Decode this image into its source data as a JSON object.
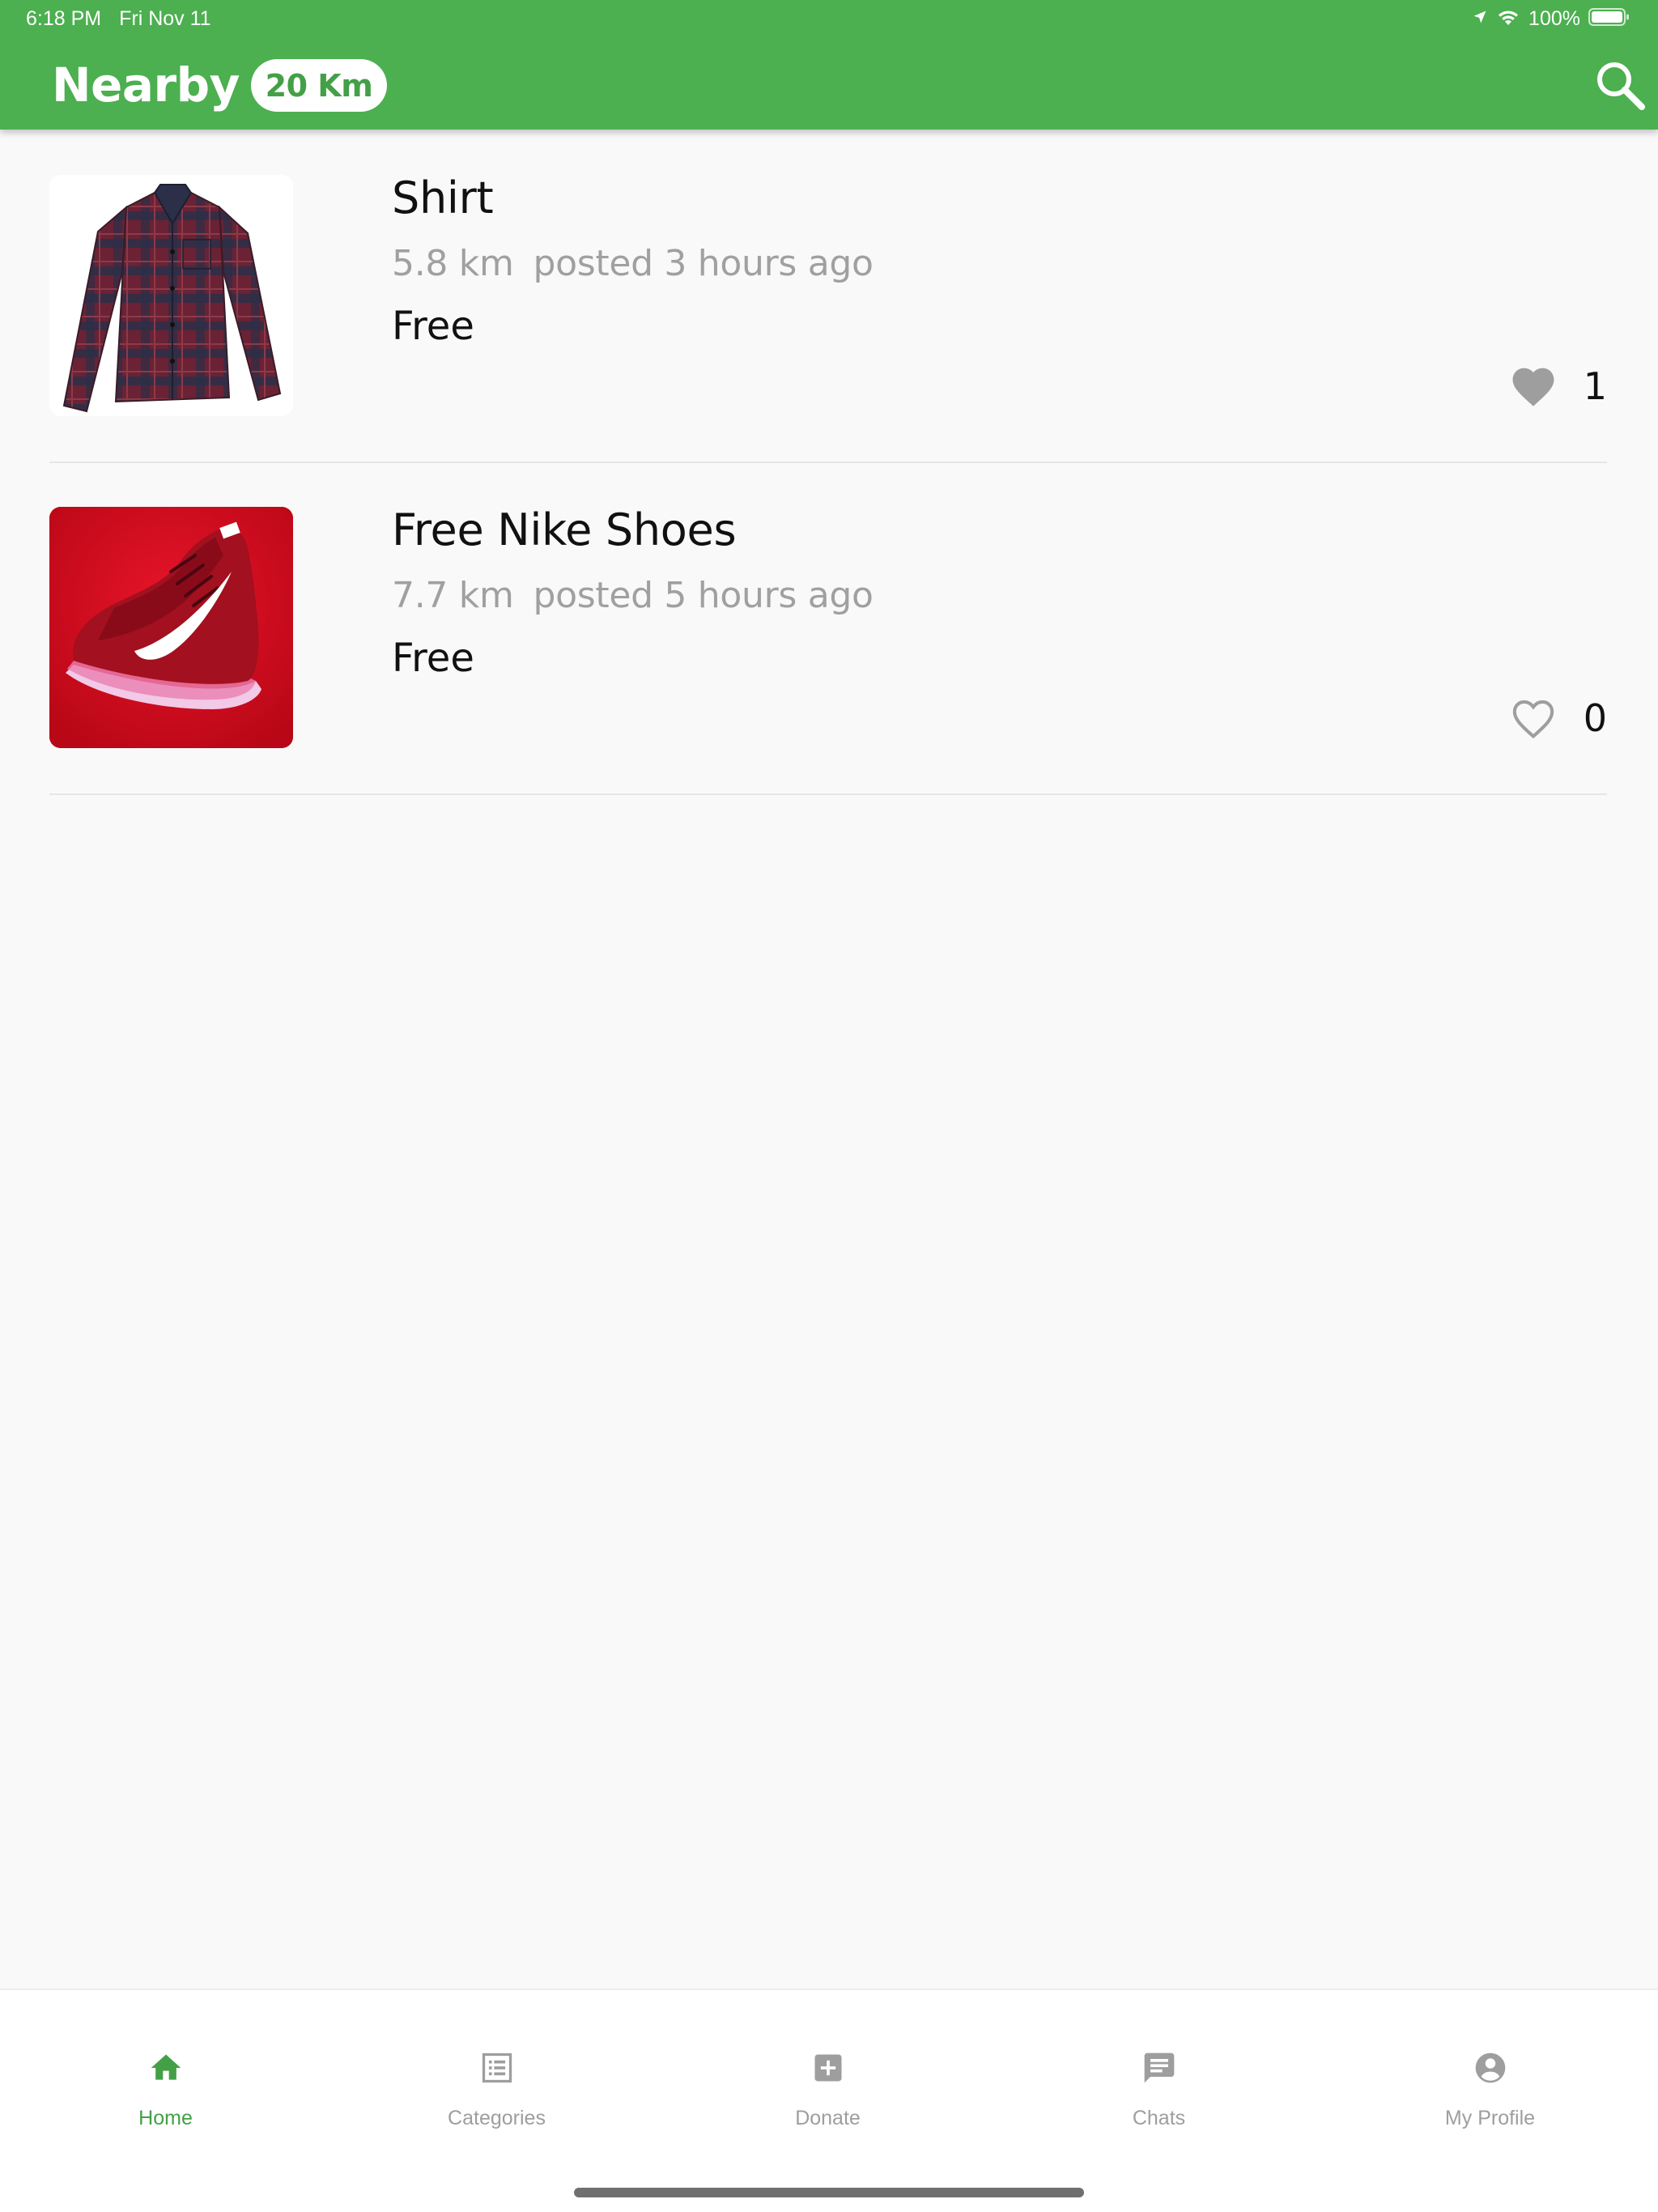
{
  "colors": {
    "primary": "#4caf50",
    "accent": "#43a047",
    "heart_filled": "#9e9e9e",
    "meta_text": "#a0a0a0",
    "tab_inactive": "#9e9e9e"
  },
  "status_bar": {
    "time": "6:18 PM",
    "date": "Fri Nov 11",
    "battery_percent": "100%",
    "icons": [
      "location-arrow-icon",
      "wifi-icon",
      "battery-icon"
    ]
  },
  "header": {
    "title": "Nearby",
    "radius_pill": "20 Km",
    "search_icon": "search-icon"
  },
  "listings": [
    {
      "title": "Shirt",
      "distance": "5.8 km",
      "posted": "posted 3 hours ago",
      "price": "Free",
      "likes": "1",
      "liked": true,
      "image": "plaid-shirt"
    },
    {
      "title": "Free Nike Shoes",
      "distance": "7.7 km",
      "posted": "posted 5 hours ago",
      "price": "Free",
      "likes": "0",
      "liked": false,
      "image": "red-sneaker"
    }
  ],
  "tabs": [
    {
      "label": "Home",
      "icon": "home-icon",
      "active": true
    },
    {
      "label": "Categories",
      "icon": "list-icon",
      "active": false
    },
    {
      "label": "Donate",
      "icon": "plus-box-icon",
      "active": false
    },
    {
      "label": "Chats",
      "icon": "chat-icon",
      "active": false
    },
    {
      "label": "My Profile",
      "icon": "account-icon",
      "active": false
    }
  ]
}
